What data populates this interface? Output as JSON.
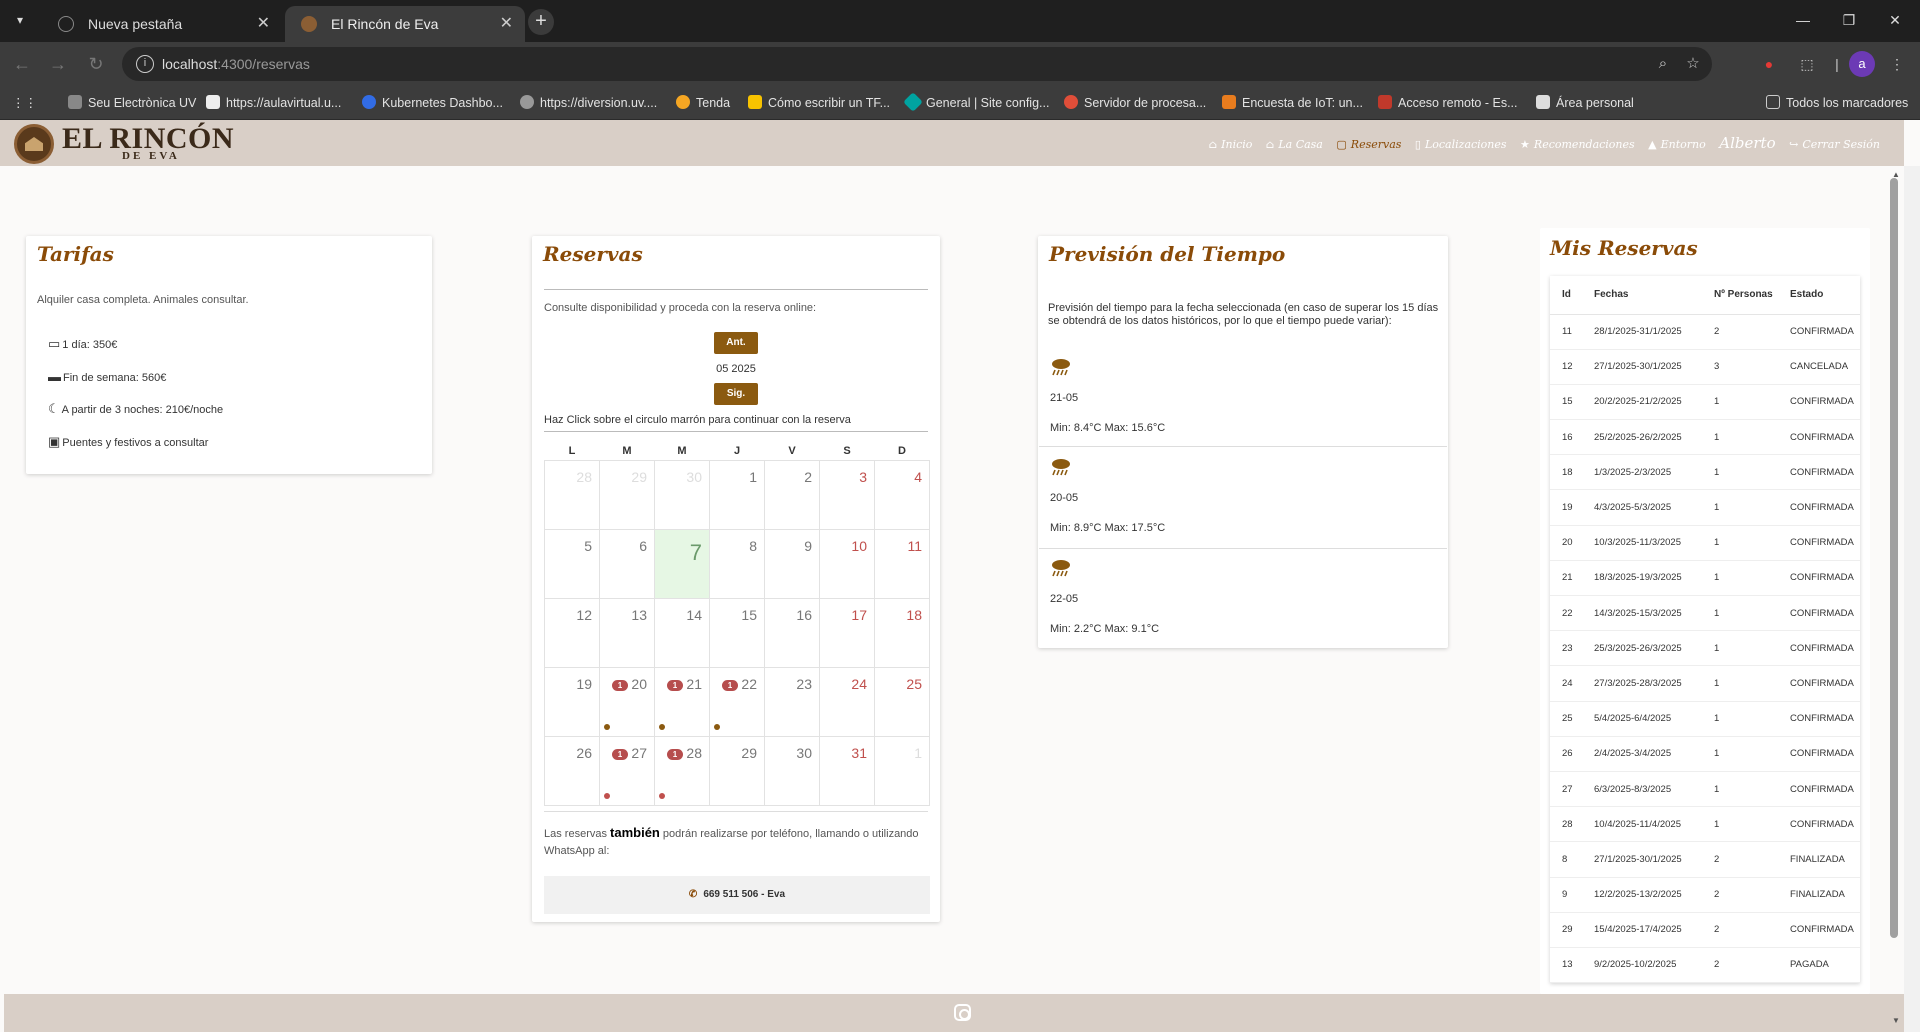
{
  "browser": {
    "tabs": [
      {
        "title": "Nueva pestaña",
        "active": false
      },
      {
        "title": "El Rincón de Eva",
        "active": true
      }
    ],
    "url_host": "localhost",
    "url_path": ":4300/reservas",
    "avatar_letter": "a",
    "bookmarks": [
      "Seu Electrònica UV",
      "https://aulavirtual.u...",
      "Kubernetes Dashbo...",
      "https://diversion.uv....",
      "Tenda",
      "Cómo escribir un TF...",
      "General | Site config...",
      "Servidor de procesa...",
      "Encuesta de IoT: un...",
      "Acceso remoto - Es...",
      "Área personal"
    ],
    "all_bookmarks": "Todos los marcadores"
  },
  "site": {
    "logo_title": "EL RINCÓN",
    "logo_sub": "DE EVA",
    "nav": [
      {
        "label": "Inicio",
        "icon": "⌂"
      },
      {
        "label": "La Casa",
        "icon": "⌂"
      },
      {
        "label": "Reservas",
        "icon": "▢"
      },
      {
        "label": "Localizaciones",
        "icon": "▯"
      },
      {
        "label": "Recomendaciones",
        "icon": "★"
      },
      {
        "label": "Entorno",
        "icon": "▲"
      }
    ],
    "user": "Alberto",
    "logout": "Cerrar Sesión"
  },
  "tarifas": {
    "title": "Tarifas",
    "intro": "Alquiler casa completa. Animales consultar.",
    "items": [
      "1 día: 350€",
      "Fin de semana: 560€",
      "A partir de 3 noches: 210€/noche",
      "Puentes y festivos a consultar"
    ]
  },
  "reservas": {
    "title": "Reservas",
    "intro": "Consulte disponibilidad y proceda con la reserva online:",
    "prev": "Ant.",
    "month": "05 2025",
    "next": "Sig.",
    "hint": "Haz Click sobre el circulo marrón para continuar con la reserva",
    "weekdays": [
      "L",
      "M",
      "M",
      "J",
      "V",
      "S",
      "D"
    ],
    "weeks": [
      [
        {
          "d": "28",
          "o": true
        },
        {
          "d": "29",
          "o": true
        },
        {
          "d": "30",
          "o": true
        },
        {
          "d": "1"
        },
        {
          "d": "2"
        },
        {
          "d": "3",
          "w": true
        },
        {
          "d": "4",
          "w": true
        }
      ],
      [
        {
          "d": "5"
        },
        {
          "d": "6"
        },
        {
          "d": "7",
          "t": true
        },
        {
          "d": "8"
        },
        {
          "d": "9"
        },
        {
          "d": "10",
          "w": true
        },
        {
          "d": "11",
          "w": true
        }
      ],
      [
        {
          "d": "12"
        },
        {
          "d": "13"
        },
        {
          "d": "14"
        },
        {
          "d": "15"
        },
        {
          "d": "16"
        },
        {
          "d": "17",
          "w": true
        },
        {
          "d": "18",
          "w": true
        }
      ],
      [
        {
          "d": "19"
        },
        {
          "d": "20",
          "b": "1",
          "dot": "brown"
        },
        {
          "d": "21",
          "b": "1",
          "dot": "brown"
        },
        {
          "d": "22",
          "b": "1",
          "dot": "brown"
        },
        {
          "d": "23"
        },
        {
          "d": "24",
          "w": true
        },
        {
          "d": "25",
          "w": true
        }
      ],
      [
        {
          "d": "26"
        },
        {
          "d": "27",
          "b": "1",
          "dot": "red"
        },
        {
          "d": "28",
          "b": "1",
          "dot": "red"
        },
        {
          "d": "29"
        },
        {
          "d": "30"
        },
        {
          "d": "31",
          "w": true
        },
        {
          "d": "1",
          "o": true
        }
      ]
    ],
    "phone_pre": "Las reservas ",
    "phone_bold": "también",
    "phone_post": " podrán realizarse por teléfono, llamando o utilizando WhatsApp al:",
    "phone": "669 511 506 - Eva"
  },
  "tiempo": {
    "title": "Previsión del Tiempo",
    "intro": "Previsión del tiempo para la fecha seleccionada (en caso de superar los 15 días se obtendrá de los datos históricos, por lo que el tiempo puede variar):",
    "days": [
      {
        "date": "21-05",
        "temp": "Min: 8.4°C Max: 15.6°C"
      },
      {
        "date": "20-05",
        "temp": "Min: 8.9°C Max: 17.5°C"
      },
      {
        "date": "22-05",
        "temp": "Min: 2.2°C Max: 9.1°C"
      }
    ]
  },
  "mis_reservas": {
    "title": "Mis Reservas",
    "headers": [
      "Id",
      "Fechas",
      "Nº Personas",
      "Estado"
    ],
    "rows": [
      [
        "11",
        "28/1/2025-31/1/2025",
        "2",
        "CONFIRMADA"
      ],
      [
        "12",
        "27/1/2025-30/1/2025",
        "3",
        "CANCELADA"
      ],
      [
        "15",
        "20/2/2025-21/2/2025",
        "1",
        "CONFIRMADA"
      ],
      [
        "16",
        "25/2/2025-26/2/2025",
        "1",
        "CONFIRMADA"
      ],
      [
        "18",
        "1/3/2025-2/3/2025",
        "1",
        "CONFIRMADA"
      ],
      [
        "19",
        "4/3/2025-5/3/2025",
        "1",
        "CONFIRMADA"
      ],
      [
        "20",
        "10/3/2025-11/3/2025",
        "1",
        "CONFIRMADA"
      ],
      [
        "21",
        "18/3/2025-19/3/2025",
        "1",
        "CONFIRMADA"
      ],
      [
        "22",
        "14/3/2025-15/3/2025",
        "1",
        "CONFIRMADA"
      ],
      [
        "23",
        "25/3/2025-26/3/2025",
        "1",
        "CONFIRMADA"
      ],
      [
        "24",
        "27/3/2025-28/3/2025",
        "1",
        "CONFIRMADA"
      ],
      [
        "25",
        "5/4/2025-6/4/2025",
        "1",
        "CONFIRMADA"
      ],
      [
        "26",
        "2/4/2025-3/4/2025",
        "1",
        "CONFIRMADA"
      ],
      [
        "27",
        "6/3/2025-8/3/2025",
        "1",
        "CONFIRMADA"
      ],
      [
        "28",
        "10/4/2025-11/4/2025",
        "1",
        "CONFIRMADA"
      ],
      [
        "8",
        "27/1/2025-30/1/2025",
        "2",
        "FINALIZADA"
      ],
      [
        "9",
        "12/2/2025-13/2/2025",
        "2",
        "FINALIZADA"
      ],
      [
        "29",
        "15/4/2025-17/4/2025",
        "2",
        "CONFIRMADA"
      ],
      [
        "13",
        "9/2/2025-10/2/2025",
        "2",
        "PAGADA"
      ]
    ]
  },
  "colors": {
    "brand_brown": "#8a4b08",
    "header_bg": "#d9cfc7",
    "dot_brown": "#8b5a10",
    "dot_red": "#c0504d"
  }
}
